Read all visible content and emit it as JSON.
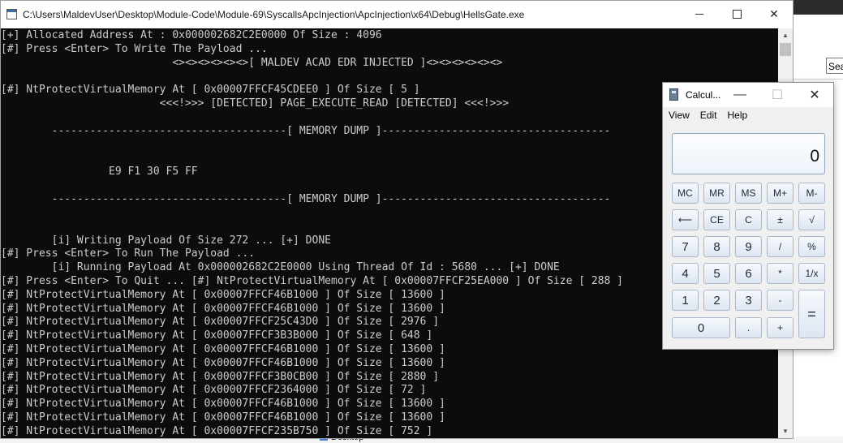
{
  "console": {
    "title": "C:\\Users\\MaldevUser\\Desktop\\Module-Code\\Module-69\\SyscallsApcInjection\\ApcInjection\\x64\\Debug\\HellsGate.exe",
    "lines": [
      "[+] Allocated Address At : 0x000002682C2E0000 Of Size : 4096",
      "[#] Press <Enter> To Write The Payload ...",
      "                           <><><><><><>[ MALDEV ACAD EDR INJECTED ]<><><><><><>",
      "",
      "[#] NtProtectVirtualMemory At [ 0x00007FFCF45CDEE0 ] Of Size [ 5 ]",
      "                         <<<!>>> [DETECTED] PAGE_EXECUTE_READ [DETECTED] <<<!>>>",
      "",
      "        -------------------------------------[ MEMORY DUMP ]------------------------------------",
      "",
      "",
      "                 E9 F1 30 F5 FF",
      "",
      "",
      "        -------------------------------------[ MEMORY DUMP ]------------------------------------",
      "",
      "",
      "        [i] Writing Payload Of Size 272 ... [+] DONE",
      "[#] Press <Enter> To Run The Payload ...",
      "        [i] Running Payload At 0x000002682C2E0000 Using Thread Of Id : 5680 ... [+] DONE",
      "[#] Press <Enter> To Quit ... [#] NtProtectVirtualMemory At [ 0x00007FFCF25EA000 ] Of Size [ 288 ]",
      "[#] NtProtectVirtualMemory At [ 0x00007FFCF46B1000 ] Of Size [ 13600 ]",
      "[#] NtProtectVirtualMemory At [ 0x00007FFCF46B1000 ] Of Size [ 13600 ]",
      "[#] NtProtectVirtualMemory At [ 0x00007FFCF25C43D0 ] Of Size [ 2976 ]",
      "[#] NtProtectVirtualMemory At [ 0x00007FFCF3B3B000 ] Of Size [ 648 ]",
      "[#] NtProtectVirtualMemory At [ 0x00007FFCF46B1000 ] Of Size [ 13600 ]",
      "[#] NtProtectVirtualMemory At [ 0x00007FFCF46B1000 ] Of Size [ 13600 ]",
      "[#] NtProtectVirtualMemory At [ 0x00007FFCF3B0CB00 ] Of Size [ 2880 ]",
      "[#] NtProtectVirtualMemory At [ 0x00007FFCF2364000 ] Of Size [ 72 ]",
      "[#] NtProtectVirtualMemory At [ 0x00007FFCF46B1000 ] Of Size [ 13600 ]",
      "[#] NtProtectVirtualMemory At [ 0x00007FFCF46B1000 ] Of Size [ 13600 ]",
      "[#] NtProtectVirtualMemory At [ 0x00007FFCF235B750 ] Of Size [ 752 ]"
    ]
  },
  "calculator": {
    "title": "Calcul...",
    "menu": [
      "View",
      "Edit",
      "Help"
    ],
    "display": "0",
    "keys": {
      "mc": "MC",
      "mr": "MR",
      "ms": "MS",
      "mplus": "M+",
      "mminus": "M-",
      "back": "⟵",
      "ce": "CE",
      "c": "C",
      "plusminus": "±",
      "sqrt": "√",
      "n7": "7",
      "n8": "8",
      "n9": "9",
      "div": "/",
      "pct": "%",
      "n4": "4",
      "n5": "5",
      "n6": "6",
      "mul": "*",
      "recip": "1/x",
      "n1": "1",
      "n2": "2",
      "n3": "3",
      "sub": "-",
      "eq": "=",
      "n0": "0",
      "dot": ".",
      "add": "+"
    }
  },
  "background": {
    "search_text": "Sea",
    "taskbar_desktop": "Desktop"
  }
}
